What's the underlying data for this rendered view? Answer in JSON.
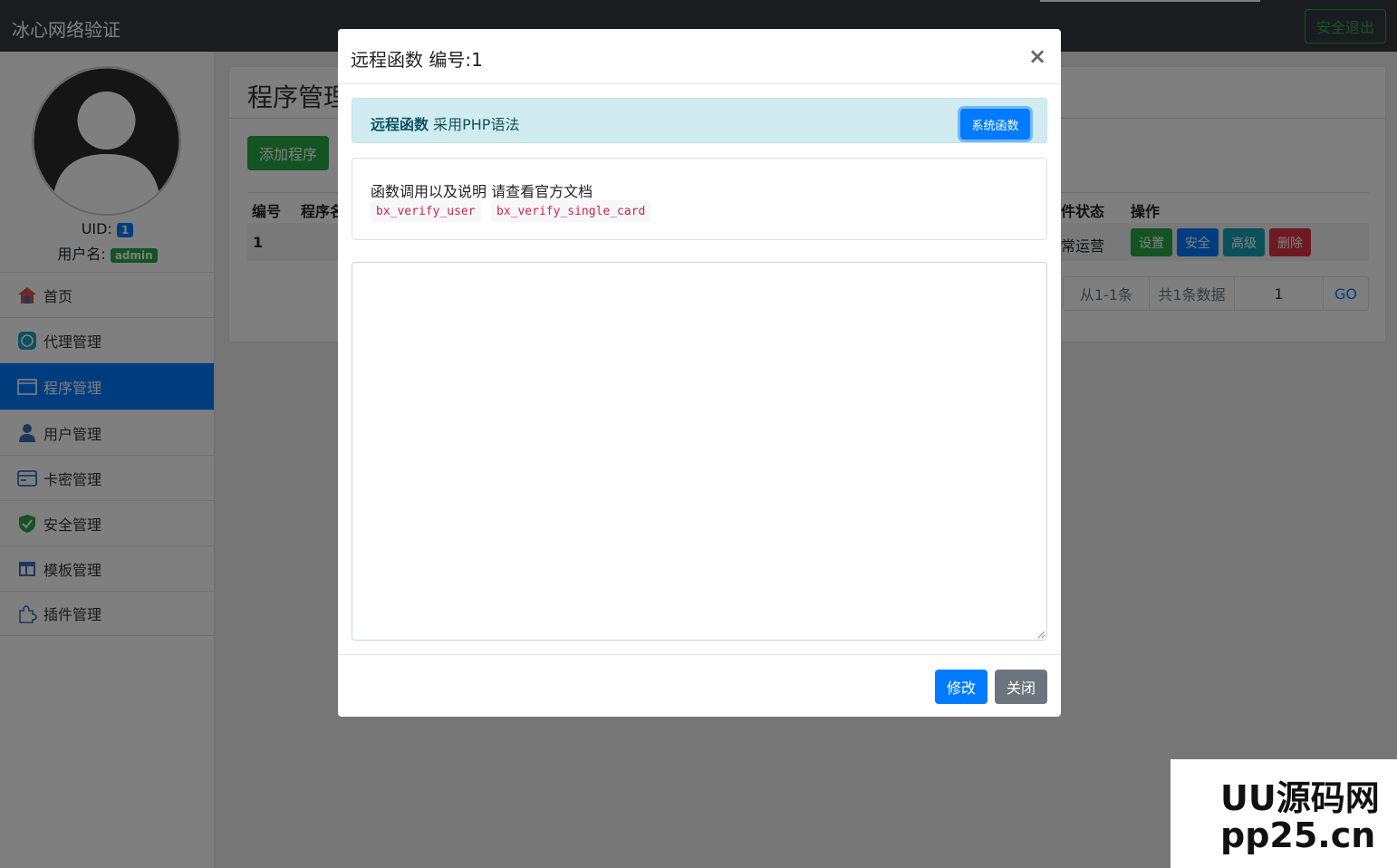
{
  "header": {
    "brand": "冰心网络验证",
    "logout_label": "安全退出"
  },
  "sidebar": {
    "uid_label": "UID:",
    "uid_value": "1",
    "username_label": "用户名:",
    "username_value": "admin",
    "items": [
      {
        "label": "首页",
        "icon": "home-icon"
      },
      {
        "label": "代理管理",
        "icon": "agent-icon"
      },
      {
        "label": "程序管理",
        "icon": "app-icon",
        "active": true
      },
      {
        "label": "用户管理",
        "icon": "user-icon"
      },
      {
        "label": "卡密管理",
        "icon": "card-icon"
      },
      {
        "label": "安全管理",
        "icon": "shield-icon"
      },
      {
        "label": "模板管理",
        "icon": "template-icon"
      },
      {
        "label": "插件管理",
        "icon": "plugin-icon"
      }
    ]
  },
  "main": {
    "title": "程序管理",
    "add_label": "添加程序",
    "columns": [
      "编号",
      "程序名",
      "件状态",
      "操作"
    ],
    "row": {
      "id": "1",
      "status": "常运营"
    },
    "row_actions": [
      "设置",
      "安全",
      "高级",
      "删除"
    ],
    "pager": {
      "range": "从1-1条",
      "total": "共1条数据",
      "page": "1",
      "go": "GO"
    }
  },
  "modal": {
    "title": "远程函数 编号:1",
    "close_symbol": "×",
    "alert_strong": "远程函数",
    "alert_text": "采用PHP语法",
    "system_button": "系统函数",
    "doc_text": "函数调用以及说明 请查看官方文档",
    "codes": [
      "bx_verify_user",
      "bx_verify_single_card"
    ],
    "editor_value": "",
    "save_label": "修改",
    "close_label": "关闭"
  },
  "watermark": {
    "line1": "UU源码网",
    "line2": "pp25.cn"
  },
  "colors": {
    "primary": "#007bff",
    "success": "#28a745",
    "info": "#17a2b8",
    "danger": "#dc3545",
    "secondary": "#6c757d"
  }
}
